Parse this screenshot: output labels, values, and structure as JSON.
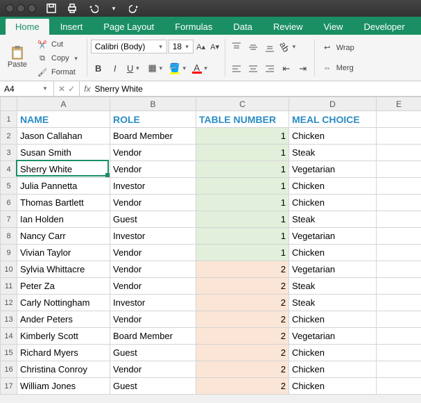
{
  "app": {
    "active_tab": "Home",
    "tabs": [
      "Home",
      "Insert",
      "Page Layout",
      "Formulas",
      "Data",
      "Review",
      "View",
      "Developer"
    ]
  },
  "clipboard": {
    "paste_label": "Paste",
    "cut_label": "Cut",
    "copy_label": "Copy",
    "format_label": "Format"
  },
  "font": {
    "name": "Calibri (Body)",
    "size": "18",
    "bold": "B",
    "italic": "I",
    "underline": "U"
  },
  "alignment": {
    "wrap_label": "Wrap",
    "merge_label": "Merg"
  },
  "namebox": {
    "ref": "A4"
  },
  "formula_bar": {
    "fx": "fx",
    "value": "Sherry White"
  },
  "columns": [
    "A",
    "B",
    "C",
    "D",
    "E"
  ],
  "header_row": {
    "A": "NAME",
    "B": "ROLE",
    "C": "TABLE NUMBER",
    "D": "MEAL CHOICE"
  },
  "rows": [
    {
      "n": "1"
    },
    {
      "n": "2",
      "A": "Jason Callahan",
      "B": "Board Member",
      "C": "1",
      "D": "Chicken"
    },
    {
      "n": "3",
      "A": "Susan Smith",
      "B": "Vendor",
      "C": "1",
      "D": "Steak"
    },
    {
      "n": "4",
      "A": "Sherry White",
      "B": "Vendor",
      "C": "1",
      "D": "Vegetarian"
    },
    {
      "n": "5",
      "A": "Julia Pannetta",
      "B": "Investor",
      "C": "1",
      "D": "Chicken"
    },
    {
      "n": "6",
      "A": "Thomas Bartlett",
      "B": "Vendor",
      "C": "1",
      "D": "Chicken"
    },
    {
      "n": "7",
      "A": "Ian Holden",
      "B": "Guest",
      "C": "1",
      "D": "Steak"
    },
    {
      "n": "8",
      "A": "Nancy Carr",
      "B": "Investor",
      "C": "1",
      "D": "Vegetarian"
    },
    {
      "n": "9",
      "A": "Vivian Taylor",
      "B": "Vendor",
      "C": "1",
      "D": "Chicken"
    },
    {
      "n": "10",
      "A": "Sylvia Whittacre",
      "B": "Vendor",
      "C": "2",
      "D": "Vegetarian"
    },
    {
      "n": "11",
      "A": "Peter Za",
      "B": "Vendor",
      "C": "2",
      "D": "Steak"
    },
    {
      "n": "12",
      "A": "Carly Nottingham",
      "B": "Investor",
      "C": "2",
      "D": "Steak"
    },
    {
      "n": "13",
      "A": "Ander Peters",
      "B": "Vendor",
      "C": "2",
      "D": "Chicken"
    },
    {
      "n": "14",
      "A": "Kimberly Scott",
      "B": "Board Member",
      "C": "2",
      "D": "Vegetarian"
    },
    {
      "n": "15",
      "A": "Richard Myers",
      "B": "Guest",
      "C": "2",
      "D": "Chicken"
    },
    {
      "n": "16",
      "A": "Christina Conroy",
      "B": "Vendor",
      "C": "2",
      "D": "Chicken"
    },
    {
      "n": "17",
      "A": "William Jones",
      "B": "Guest",
      "C": "2",
      "D": "Chicken"
    }
  ],
  "active_cell": {
    "row": 4,
    "col": "A"
  },
  "icons": {
    "save": "save-icon",
    "undo": "undo-icon",
    "redo": "redo-icon",
    "scissors": "scissors-icon",
    "copy": "copy-icon",
    "brush": "brush-icon",
    "clipboard": "clipboard-icon"
  }
}
